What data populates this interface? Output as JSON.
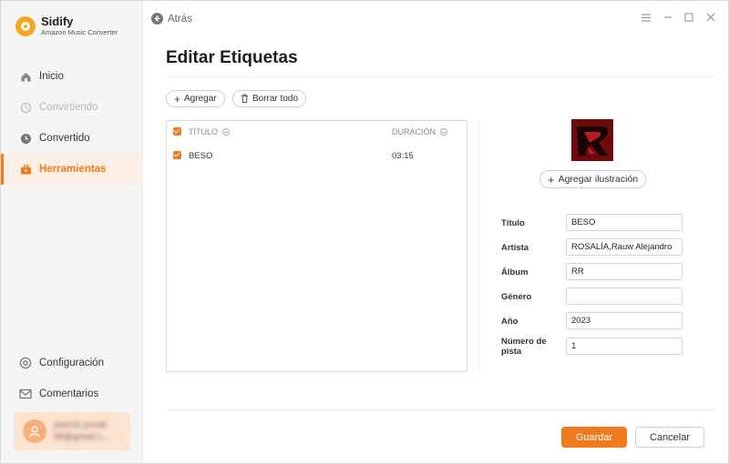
{
  "brand": {
    "name": "Sidify",
    "subtitle": "Amazon Music Converter"
  },
  "nav": {
    "items": [
      {
        "label": "Inicio",
        "icon": "home-icon",
        "state": "normal"
      },
      {
        "label": "Convirtiendo",
        "icon": "sync-icon",
        "state": "disabled"
      },
      {
        "label": "Convertido",
        "icon": "clock-icon",
        "state": "normal"
      },
      {
        "label": "Herramientas",
        "icon": "toolbox-icon",
        "state": "active"
      }
    ],
    "bottom": [
      {
        "label": "Configuración",
        "icon": "gear-icon"
      },
      {
        "label": "Comentarios",
        "icon": "mail-icon"
      }
    ]
  },
  "user": {
    "line1": "patrick.portal",
    "line2": "68@gmail.c..."
  },
  "topbar": {
    "back_label": "Atrás"
  },
  "page": {
    "title": "Editar Etiquetas"
  },
  "toolbar": {
    "add_label": "Agregar",
    "clear_label": "Borrar todo"
  },
  "table": {
    "headers": {
      "title": "TÍTULO",
      "duration": "DURACIÓN"
    },
    "rows": [
      {
        "title": "BESO",
        "duration": "03:15",
        "checked": true
      }
    ]
  },
  "artwork": {
    "add_label": "Agregar ilustración"
  },
  "fields": [
    {
      "label": "Título",
      "value": "BESO"
    },
    {
      "label": "Artista",
      "value": "ROSALÍA,Rauw Alejandro"
    },
    {
      "label": "Álbum",
      "value": "RR"
    },
    {
      "label": "Género",
      "value": ""
    },
    {
      "label": "Año",
      "value": "2023"
    },
    {
      "label": "Número de pista",
      "value": "1"
    }
  ],
  "actions": {
    "save_label": "Guardar",
    "cancel_label": "Cancelar"
  },
  "colors": {
    "accent": "#f07b1e"
  }
}
